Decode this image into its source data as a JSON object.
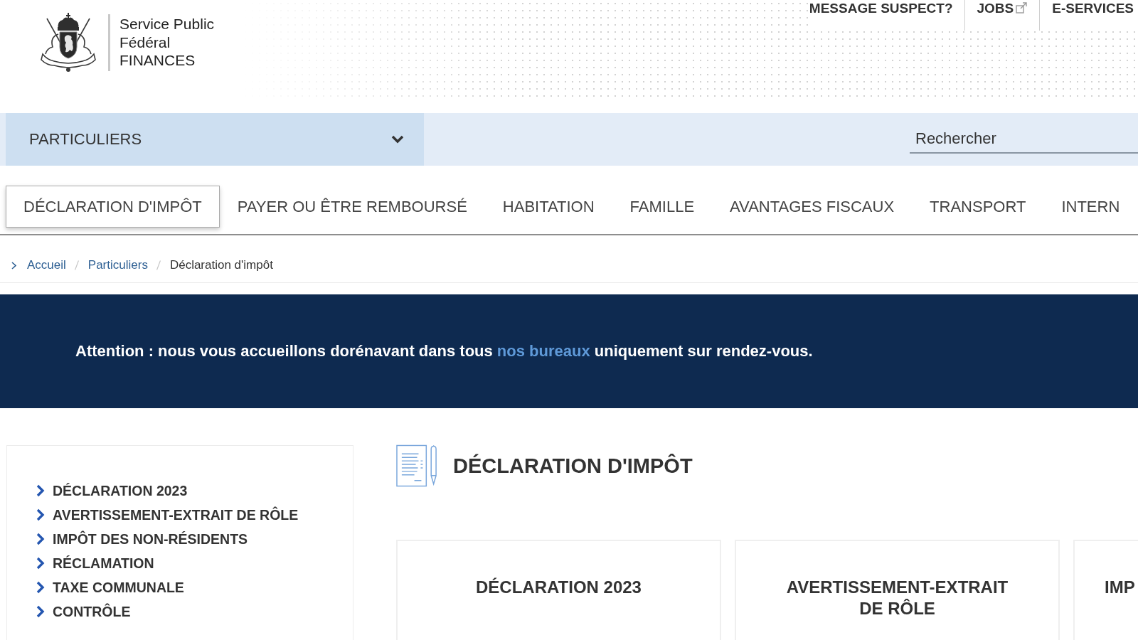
{
  "header": {
    "agency_name": [
      "Service Public",
      "Fédéral",
      "FINANCES"
    ],
    "top_links": [
      {
        "label": "MESSAGE SUSPECT?",
        "external": false
      },
      {
        "label": "JOBS",
        "external": true
      },
      {
        "label": "E-SERVICES",
        "external": false
      }
    ]
  },
  "audience_bar": {
    "selector": {
      "value": "PARTICULIERS"
    },
    "search": {
      "placeholder": "Rechercher"
    }
  },
  "tabs": [
    {
      "label": "DÉCLARATION D'IMPÔT",
      "selected": true
    },
    {
      "label": "PAYER OU ÊTRE REMBOURSÉ",
      "selected": false
    },
    {
      "label": "HABITATION",
      "selected": false
    },
    {
      "label": "FAMILLE",
      "selected": false
    },
    {
      "label": "AVANTAGES FISCAUX",
      "selected": false
    },
    {
      "label": "TRANSPORT",
      "selected": false
    },
    {
      "label": "INTERN",
      "selected": false
    }
  ],
  "breadcrumb": [
    {
      "label": "Accueil",
      "kind": "link"
    },
    {
      "label": "Particuliers",
      "kind": "link"
    },
    {
      "label": "Déclaration d'impôt",
      "kind": "current"
    }
  ],
  "notice": {
    "before": "Attention : nous vous accueillons dorénavant dans tous",
    "link": "nos bureaux",
    "after": "uniquement sur rendez-vous."
  },
  "sidebar": {
    "items": [
      "DÉCLARATION 2023",
      "AVERTISSEMENT-EXTRAIT DE RÔLE",
      "IMPÔT DES NON-RÉSIDENTS",
      "RÉCLAMATION",
      "TAXE COMMUNALE",
      "CONTRÔLE"
    ]
  },
  "page_title": "DÉCLARATION D'IMPÔT",
  "cards": [
    {
      "title": "DÉCLARATION 2023"
    },
    {
      "title": "AVERTISSEMENT-EXTRAIT DE RÔLE"
    },
    {
      "title": "IMP"
    }
  ]
}
